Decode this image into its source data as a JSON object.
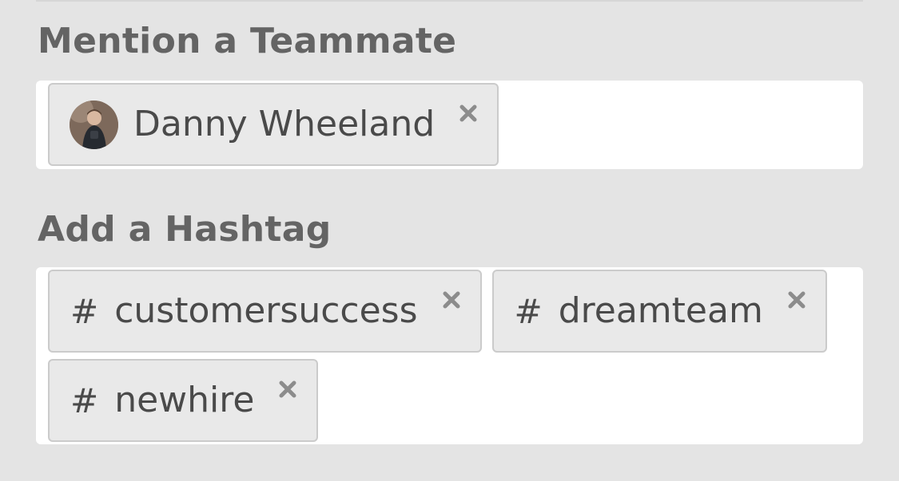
{
  "mention": {
    "label": "Mention a Teammate",
    "tokens": [
      {
        "name": "Danny Wheeland",
        "avatar_icon": "user-photo"
      }
    ]
  },
  "hashtag": {
    "label": "Add a Hashtag",
    "prefix": "#",
    "tokens": [
      {
        "text": "customersuccess"
      },
      {
        "text": "dreamteam"
      },
      {
        "text": "newhire"
      }
    ]
  },
  "icons": {
    "remove": "close-icon"
  },
  "colors": {
    "page_background": "#e4e4e4",
    "field_background": "#ffffff",
    "token_background": "#e9e9e9",
    "token_border": "#cbcbcb",
    "label_text": "#646464",
    "token_text": "#4a4a4a",
    "remove_icon": "#8c8c8c"
  }
}
